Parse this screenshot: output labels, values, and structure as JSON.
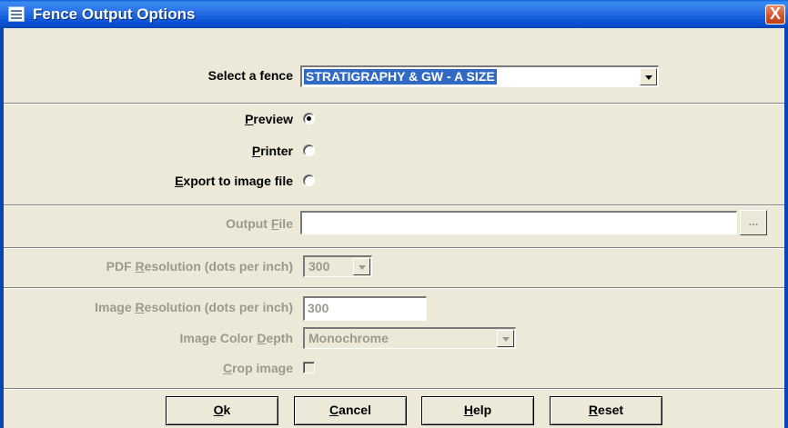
{
  "window": {
    "title": "Fence Output Options",
    "close_glyph": "X",
    "icon": "app-icon"
  },
  "fence": {
    "label": "Select a fence",
    "selected": "STRATIGRAPHY & GW - A SIZE"
  },
  "output_mode": {
    "preview": {
      "hotkey": "P",
      "rest": "review",
      "checked": true
    },
    "printer": {
      "hotkey": "P",
      "rest": "rinter",
      "checked": false
    },
    "export": {
      "hotkey": "E",
      "rest": "xport to image file",
      "checked": false
    }
  },
  "output_file": {
    "pre": "Output ",
    "hotkey": "F",
    "post": "ile",
    "value": "",
    "browse_label": "..."
  },
  "pdf_resolution": {
    "pre": "PDF ",
    "hotkey": "R",
    "post": "esolution (dots per inch)",
    "value": "300"
  },
  "image_resolution": {
    "pre": "Image ",
    "hotkey": "R",
    "post": "esolution (dots per inch)",
    "value": "300"
  },
  "image_color_depth": {
    "pre": "Image Color ",
    "hotkey": "D",
    "post": "epth",
    "value": "Monochrome"
  },
  "crop_image": {
    "hotkey": "C",
    "post": "rop image",
    "checked": false
  },
  "buttons": {
    "ok": {
      "hotkey": "O",
      "rest": "k"
    },
    "cancel": {
      "hotkey": "C",
      "rest": "ancel"
    },
    "help": {
      "hotkey": "H",
      "rest": "elp"
    },
    "reset": {
      "hotkey": "R",
      "rest": "eset"
    }
  },
  "colors": {
    "titlebar": "#0a52d4",
    "face": "#ece9d8",
    "selection": "#316ac5",
    "disabled_text": "#9a9a8e",
    "close": "#d2502a"
  }
}
